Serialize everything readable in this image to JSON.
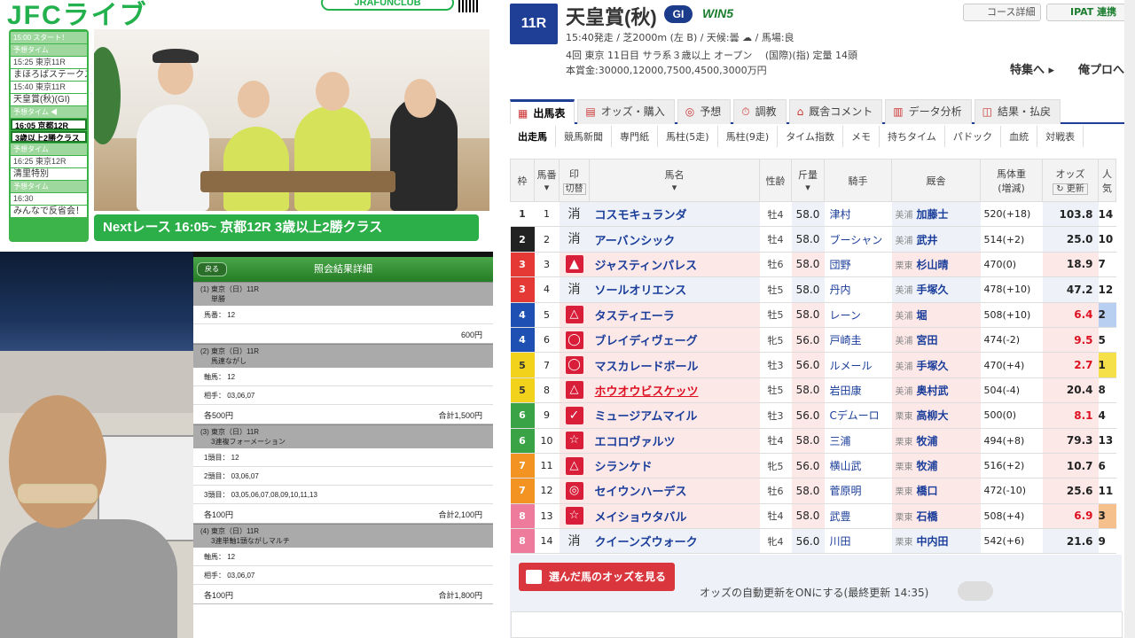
{
  "stream": {
    "logo": "JFCライブ",
    "club": "JRAFUNCLUB",
    "next_banner": "Nextレース 16:05~ 京都12R 3歳以上2勝クラス",
    "schedule": [
      {
        "t": "15:00 スタート！",
        "c": "h"
      },
      {
        "t": "予想タイム",
        "c": "h"
      },
      {
        "t": "15:25 東京11R",
        "c": "w"
      },
      {
        "t": "まほろばステークス(L)",
        "c": "w2"
      },
      {
        "t": "15:40 東京11R",
        "c": "w"
      },
      {
        "t": "天皇賞(秋)(GI)",
        "c": "w2"
      },
      {
        "t": "予想タイム ◀",
        "c": "h"
      },
      {
        "t": "16:05 京都12R",
        "c": "act"
      },
      {
        "t": "3歳以上2勝クラス",
        "c": "act"
      },
      {
        "t": "予想タイム",
        "c": "h"
      },
      {
        "t": "16:25 東京12R",
        "c": "w"
      },
      {
        "t": "清里特別",
        "c": "w2"
      },
      {
        "t": "予想タイム",
        "c": "h"
      },
      {
        "t": "16:30",
        "c": "w"
      },
      {
        "t": "みんなで反省会！",
        "c": "w2"
      }
    ]
  },
  "result": {
    "title": "照会結果詳細",
    "back": "戻る",
    "sections": [
      {
        "head1": "(1) 東京（日）11R",
        "head2": "単勝",
        "rows": [
          "馬番： 12"
        ],
        "left": "",
        "right": "600円"
      },
      {
        "head1": "(2) 東京（日）11R",
        "head2": "馬連ながし",
        "rows": [
          "軸馬： 12",
          "相手： 03,06,07"
        ],
        "left": "各500円",
        "right": "合計1,500円"
      },
      {
        "head1": "(3) 東京（日）11R",
        "head2": "3連複フォーメーション",
        "rows": [
          "1頭目： 12",
          "2頭目： 03,06,07",
          "3頭目： 03,05,06,07,08,09,10,11,13"
        ],
        "left": "各100円",
        "right": "合計2,100円"
      },
      {
        "head1": "(4) 東京（日）11R",
        "head2": "3連単軸1頭ながしマルチ",
        "rows": [
          "軸馬： 12",
          "相手： 03,06,07"
        ],
        "left": "各100円",
        "right": "合計1,800円"
      }
    ]
  },
  "race": {
    "no": "11R",
    "name": "天皇賞(秋)",
    "grade": "GI",
    "win5": "WIN5",
    "btn_course": "コース詳細",
    "btn_ipat": "IPAT 連携",
    "info1": "15:40発走 / 芝2000m (左 B) / 天候:曇 ☁ / 馬場:良",
    "info2": "4回 東京 11日目 サラ系３歳以上 オープン　 (国際)(指) 定量 14頭",
    "info3": "本賞金:30000,12000,7500,4500,3000万円",
    "link_feature": "特集へ ▸",
    "link_prev": "俺プロへ ▸"
  },
  "tabs": [
    {
      "label": "出馬表",
      "on": true
    },
    {
      "label": "オッズ・購入"
    },
    {
      "label": "予想"
    },
    {
      "label": "調教"
    },
    {
      "label": "厩舎コメント"
    },
    {
      "label": "データ分析"
    },
    {
      "label": "結果・払戻"
    }
  ],
  "subtabs": [
    "出走馬",
    "競馬新聞",
    "専門紙",
    "馬柱(5走)",
    "馬柱(9走)",
    "タイム指数",
    "メモ",
    "持ちタイム",
    "パドック",
    "血統",
    "対戦表"
  ],
  "headers": {
    "waku": "枠",
    "uma": "馬番",
    "mark": "印",
    "mark2": "切替",
    "name": "馬名",
    "age": "性齢",
    "wt": "斤量",
    "jk": "騎手",
    "stable": "厩舎",
    "bw": "馬体重",
    "bw2": "(増減)",
    "odds": "オッズ",
    "upd": "更新",
    "pop": "人気"
  },
  "colors": {
    "waku1": "#ffffff",
    "waku2": "#222222",
    "waku3": "#e53935",
    "waku4": "#1e50b4",
    "waku5": "#f2d21b",
    "waku6": "#3aa346",
    "waku7": "#f39322",
    "waku8": "#ef7b9c",
    "accent": "#1f3f96"
  },
  "horses": [
    {
      "w": "1",
      "n": "1",
      "m": "消",
      "mt": "txt",
      "name": "コスモキュランダ",
      "age": "牡4",
      "wt": "58.0",
      "jk": "津村",
      "sa": "美浦",
      "st": "加藤士",
      "bw": "520(+18)",
      "od": "103.8",
      "pop": "14"
    },
    {
      "w": "2",
      "n": "2",
      "m": "消",
      "mt": "txt",
      "name": "アーバンシック",
      "age": "牡4",
      "wt": "58.0",
      "jk": "ブーシャン",
      "sa": "美浦",
      "st": "武井",
      "bw": "514(+2)",
      "od": "25.0",
      "pop": "10"
    },
    {
      "w": "3",
      "n": "3",
      "m": "▲",
      "mt": "solid",
      "name": "ジャスティンパレス",
      "age": "牡6",
      "wt": "58.0",
      "jk": "団野",
      "sa": "栗東",
      "st": "杉山晴",
      "bw": "470(0)",
      "od": "18.9",
      "pop": "7",
      "hl": true
    },
    {
      "w": "3",
      "n": "4",
      "m": "消",
      "mt": "txt",
      "name": "ソールオリエンス",
      "age": "牡5",
      "wt": "58.0",
      "jk": "丹内",
      "sa": "美浦",
      "st": "手塚久",
      "bw": "478(+10)",
      "od": "47.2",
      "pop": "12"
    },
    {
      "w": "4",
      "n": "5",
      "m": "△",
      "mt": "ol",
      "name": "タスティエーラ",
      "age": "牡5",
      "wt": "58.0",
      "jk": "レーン",
      "sa": "美浦",
      "st": "堀",
      "bw": "508(+10)",
      "od": "6.4",
      "pop": "2",
      "hl": true,
      "red": true
    },
    {
      "w": "4",
      "n": "6",
      "m": "◯",
      "mt": "ol",
      "name": "ブレイディヴェーグ",
      "age": "牝5",
      "wt": "56.0",
      "jk": "戸崎圭",
      "sa": "美浦",
      "st": "宮田",
      "bw": "474(-2)",
      "od": "9.5",
      "pop": "5",
      "hl": true,
      "red": true
    },
    {
      "w": "5",
      "n": "7",
      "m": "◯",
      "mt": "ol",
      "name": "マスカレードボール",
      "age": "牡3",
      "wt": "56.0",
      "jk": "ルメール",
      "sa": "美浦",
      "st": "手塚久",
      "bw": "470(+4)",
      "od": "2.7",
      "pop": "1",
      "hl": true,
      "red": true
    },
    {
      "w": "5",
      "n": "8",
      "m": "△",
      "mt": "ol",
      "name": "ホウオウビスケッツ",
      "age": "牡5",
      "wt": "58.0",
      "jk": "岩田康",
      "sa": "美浦",
      "st": "奥村武",
      "bw": "504(-4)",
      "od": "20.4",
      "pop": "8",
      "hl": true,
      "link": true
    },
    {
      "w": "6",
      "n": "9",
      "m": "✓",
      "mt": "solid",
      "name": "ミュージアムマイル",
      "age": "牡3",
      "wt": "56.0",
      "jk": "Cデムーロ",
      "sa": "栗東",
      "st": "高柳大",
      "bw": "500(0)",
      "od": "8.1",
      "pop": "4",
      "hl": true,
      "red": true
    },
    {
      "w": "6",
      "n": "10",
      "m": "☆",
      "mt": "ol",
      "name": "エコロヴァルツ",
      "age": "牡4",
      "wt": "58.0",
      "jk": "三浦",
      "sa": "栗東",
      "st": "牧浦",
      "bw": "494(+8)",
      "od": "79.3",
      "pop": "13",
      "hl": true
    },
    {
      "w": "7",
      "n": "11",
      "m": "△",
      "mt": "ol",
      "name": "シランケド",
      "age": "牝5",
      "wt": "56.0",
      "jk": "横山武",
      "sa": "栗東",
      "st": "牧浦",
      "bw": "516(+2)",
      "od": "10.7",
      "pop": "6",
      "hl": true
    },
    {
      "w": "7",
      "n": "12",
      "m": "◎",
      "mt": "ol",
      "name": "セイウンハーデス",
      "age": "牡6",
      "wt": "58.0",
      "jk": "菅原明",
      "sa": "栗東",
      "st": "橋口",
      "bw": "472(-10)",
      "od": "25.6",
      "pop": "11",
      "hl": true
    },
    {
      "w": "8",
      "n": "13",
      "m": "☆",
      "mt": "ol",
      "name": "メイショウタバル",
      "age": "牡4",
      "wt": "58.0",
      "jk": "武豊",
      "sa": "栗東",
      "st": "石橋",
      "bw": "508(+4)",
      "od": "6.9",
      "pop": "3",
      "hl": true,
      "red": true
    },
    {
      "w": "8",
      "n": "14",
      "m": "消",
      "mt": "txt",
      "name": "クイーンズウォーク",
      "age": "牝4",
      "wt": "56.0",
      "jk": "川田",
      "sa": "栗東",
      "st": "中内田",
      "bw": "542(+6)",
      "od": "21.6",
      "pop": "9"
    }
  ],
  "bottom": {
    "odds_btn": "選んだ馬のオッズを見る",
    "auto": "オッズの自動更新をONにする(最終更新 14:35)"
  }
}
